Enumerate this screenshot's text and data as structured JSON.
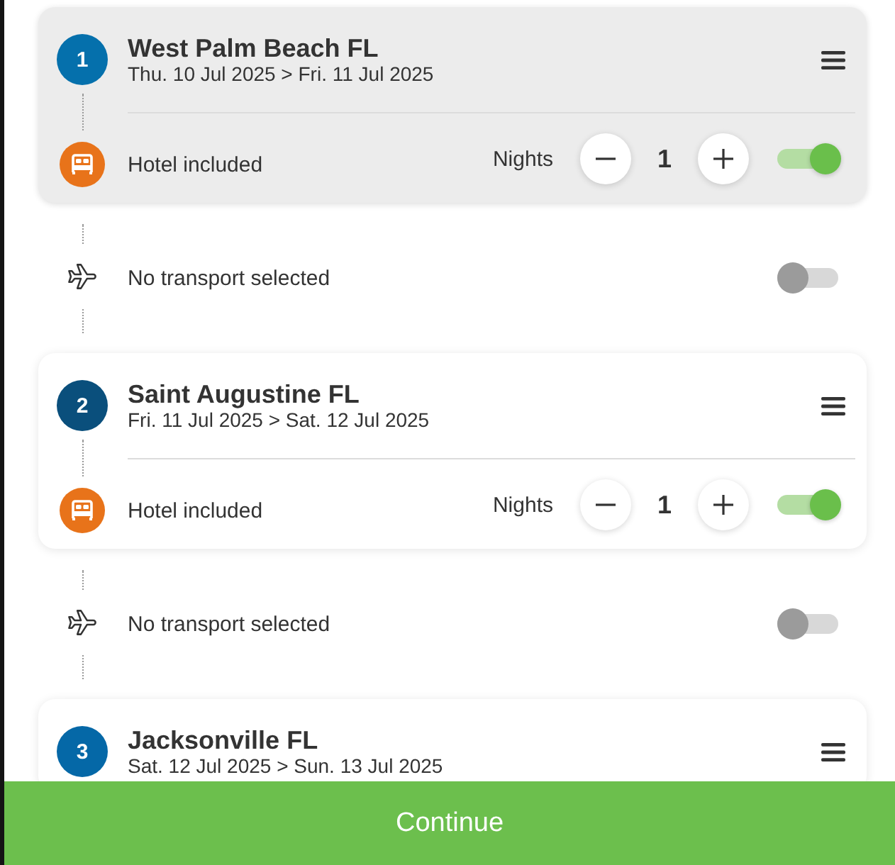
{
  "stops": [
    {
      "number": "1",
      "title": "West Palm Beach FL",
      "dates": "Thu. 10 Jul 2025 > Fri. 11 Jul 2025",
      "color": "#0570ac",
      "selected": true,
      "hotel": {
        "label": "Hotel included",
        "nights_label": "Nights",
        "nights": "1",
        "on": true
      },
      "transport": {
        "label": "No transport selected",
        "on": false
      }
    },
    {
      "number": "2",
      "title": "Saint Augustine FL",
      "dates": "Fri. 11 Jul 2025 > Sat. 12 Jul 2025",
      "color": "#0a4f7c",
      "selected": false,
      "hotel": {
        "label": "Hotel included",
        "nights_label": "Nights",
        "nights": "1",
        "on": true
      },
      "transport": {
        "label": "No transport selected",
        "on": false
      }
    },
    {
      "number": "3",
      "title": "Jacksonville FL",
      "dates": "Sat. 12 Jul 2025 > Sun. 13 Jul 2025",
      "color": "#0568a7",
      "selected": false
    }
  ],
  "continue_button": "Continue"
}
